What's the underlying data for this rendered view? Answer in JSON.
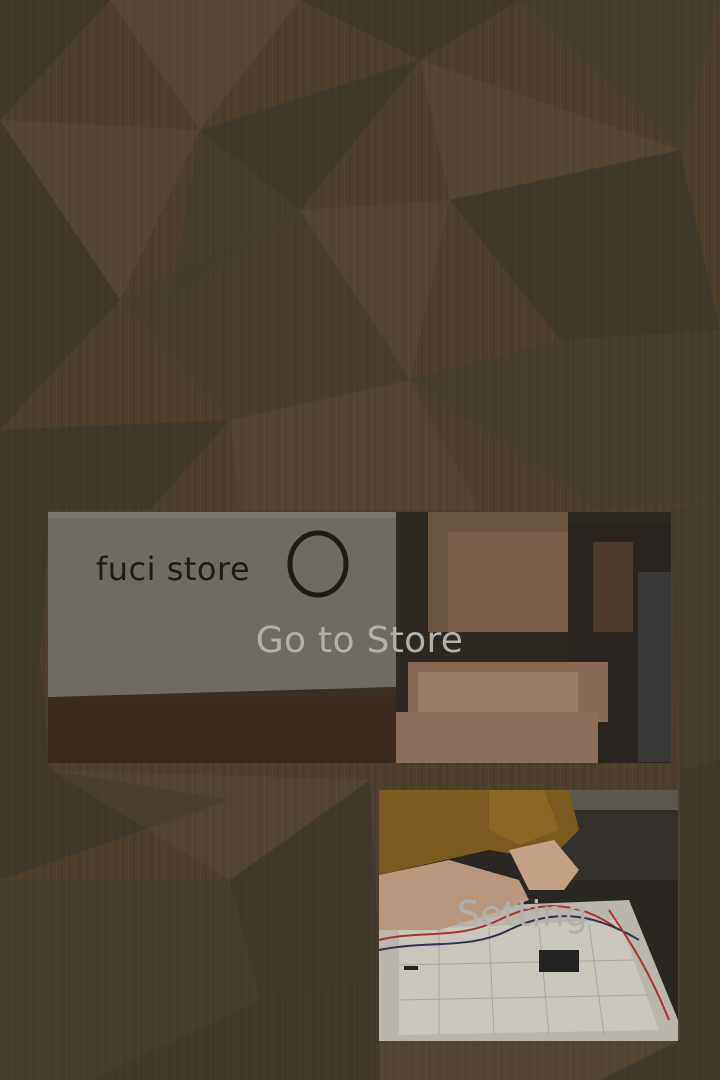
{
  "background": {
    "description_colors": {
      "wood_base": "#5e4e39",
      "facet_light": "#77674f",
      "facet_dark": "#3f3f33",
      "facet_olive": "#4b4b3b"
    }
  },
  "tiles": {
    "store": {
      "label": "Go to Store",
      "box_print": "fuci store"
    },
    "setting": {
      "label": "Setting"
    }
  },
  "colors": {
    "label_text": "#b3b0ab",
    "overlay": "rgba(0,0,0,0.18)"
  }
}
